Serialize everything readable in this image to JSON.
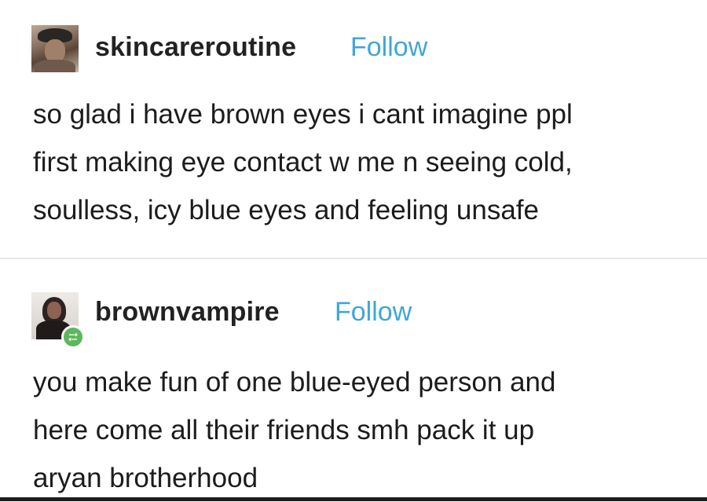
{
  "posts": [
    {
      "username": "skincareroutine",
      "follow_label": "Follow",
      "avatar_icon": "user-avatar-photo",
      "lines": [
        "so glad i have brown eyes i cant imagine ppl",
        "first making eye contact w me n seeing cold,",
        "soulless, icy blue eyes and feeling unsafe"
      ]
    },
    {
      "username": "brownvampire",
      "follow_label": "Follow",
      "avatar_icon": "user-avatar-photo",
      "badge_icon": "reblog-icon",
      "lines": [
        "you make fun of one blue-eyed person and",
        "here come all their friends smh pack it up",
        "aryan brotherhood"
      ]
    }
  ],
  "colors": {
    "follow": "#3fa6db",
    "reblog_badge": "#5cb85c",
    "text": "#1c1c1c"
  }
}
